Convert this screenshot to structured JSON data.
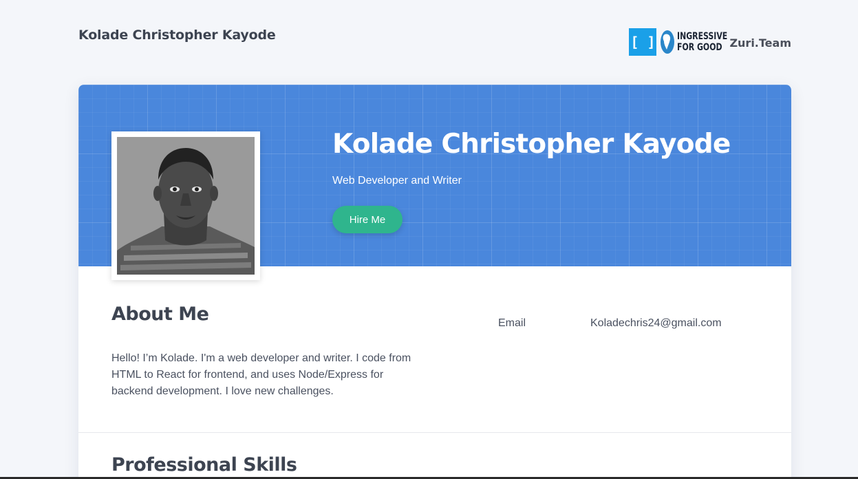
{
  "header": {
    "site_name": "Kolade Christopher Kayode",
    "logos": {
      "bracket_logo": "[ ]",
      "ingressive_line1": "INGRESSIVE",
      "ingressive_line2": "FOR GOOD",
      "zuri": "Zuri.Team"
    }
  },
  "hero": {
    "name": "Kolade Christopher Kayode",
    "role": "Web Developer and Writer",
    "hire_label": "Hire Me",
    "photo_icon": "profile-photo"
  },
  "about": {
    "title": "About Me",
    "text": "Hello! I’m Kolade. I'm a web developer and writer. I code from HTML to React for frontend, and uses Node/Express for backend development. I love new challenges."
  },
  "contact": {
    "email_label": "Email",
    "email_value": "Koladechris24@gmail.com"
  },
  "skills": {
    "title": "Professional Skills"
  },
  "colors": {
    "hero_blue": "#4a87dc",
    "button_green": "#2fb58d",
    "page_bg": "#f4f6fa",
    "text_dark": "#3d4451"
  }
}
